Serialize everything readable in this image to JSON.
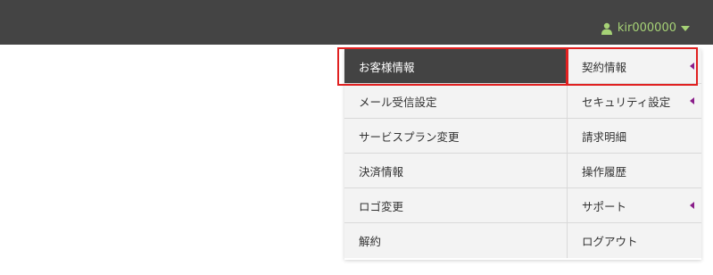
{
  "header": {
    "username": "kir000000"
  },
  "menu": {
    "left": [
      {
        "label": "お客様情報",
        "active": true
      },
      {
        "label": "メール受信設定"
      },
      {
        "label": "サービスプラン変更"
      },
      {
        "label": "決済情報"
      },
      {
        "label": "ロゴ変更"
      },
      {
        "label": "解約"
      }
    ],
    "right": [
      {
        "label": "契約情報",
        "submenu": true
      },
      {
        "label": "セキュリティ設定",
        "submenu": true
      },
      {
        "label": "請求明細"
      },
      {
        "label": "操作履歴"
      },
      {
        "label": "サポート",
        "submenu": true
      },
      {
        "label": "ログアウト"
      }
    ]
  },
  "colors": {
    "topbar": "#444444",
    "username": "#a6d276",
    "active_bg": "#434343",
    "submenu_arrow": "#8a1d8a",
    "highlight": "#e02020"
  }
}
